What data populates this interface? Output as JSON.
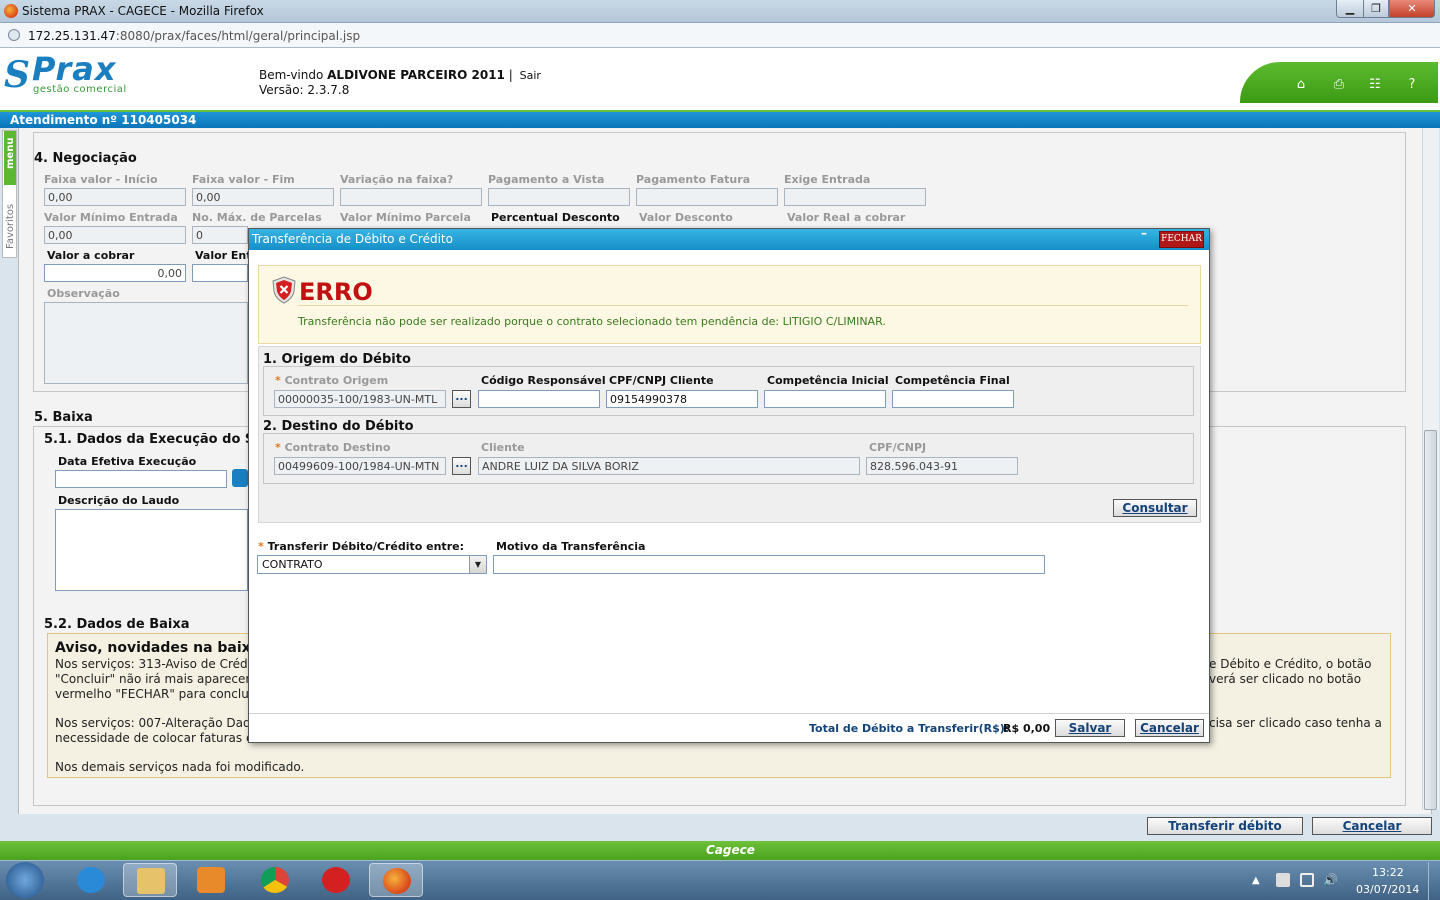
{
  "window": {
    "title": "Sistema PRAX - CAGECE - Mozilla Firefox",
    "url_host": "172.25.131.47",
    "url_path": ":8080/prax/faces/html/geral/principal.jsp"
  },
  "header": {
    "logo_text": "Prax",
    "logo_sub": "gestão comercial",
    "welcome_prefix": "Bem-vindo",
    "user_name": "ALDIVONE PARCEIRO 2011",
    "separator": "|",
    "sair": "Sair",
    "version": "Versão: 2.3.7.8"
  },
  "atendimento": "Atendimento nº 110405034",
  "sidebar": {
    "menu": "menu",
    "favoritos": "Favoritos"
  },
  "negociacao": {
    "title": "4. Negociação",
    "row1": [
      {
        "label": "Faixa valor - Início",
        "value": "0,00"
      },
      {
        "label": "Faixa valor - Fim",
        "value": "0,00"
      },
      {
        "label": "Variação na faixa?",
        "value": ""
      },
      {
        "label": "Pagamento a Vista",
        "value": ""
      },
      {
        "label": "Pagamento Fatura",
        "value": ""
      },
      {
        "label": "Exige Entrada",
        "value": ""
      }
    ],
    "row2": [
      {
        "label": "Valor Mínimo Entrada",
        "value": "0,00"
      },
      {
        "label": "No. Máx. de Parcelas",
        "value": "0"
      },
      {
        "label": "Valor Mínimo Parcela",
        "value": ""
      },
      {
        "label": "Percentual Desconto",
        "value": ""
      },
      {
        "label": "Valor Desconto",
        "value": ""
      },
      {
        "label": "Valor Real a cobrar",
        "value": ""
      }
    ],
    "valor_cobrar_label": "Valor a cobrar",
    "valor_cobrar_value": "0,00",
    "valor_entrada_label": "Valor Ent",
    "observacao_label": "Observação"
  },
  "baixa": {
    "title": "5. Baixa",
    "sub1": "5.1. Dados da Execução do S",
    "data_label": "Data Efetiva Execução",
    "laudo_label": "Descrição do Laudo",
    "sub2": "5.2. Dados de Baixa",
    "aviso_title": "Aviso, novidades na baixa",
    "aviso_l1a": "Nos serviços: 313-Aviso de Crédit",
    "aviso_l1b": "e Débito e Crédito, o botão",
    "aviso_l2a": "\"Concluir\" não irá mais aparecer",
    "aviso_l2b": "verá ser clicado no botão",
    "aviso_l3a": "vermelho \"FECHAR\" para concluir",
    "aviso_l4a": "Nos serviços: 007-Alteração Dado",
    "aviso_l4b": "cisa ser clicado caso tenha a",
    "aviso_l5a": "necessidade de colocar faturas en",
    "aviso_l6": "Nos demais serviços nada foi modificado."
  },
  "bottom_buttons": {
    "transferir": "Transferir débito",
    "cancelar": "Cancelar"
  },
  "footer": "Cagece",
  "taskbar": {
    "time": "13:22",
    "date": "03/07/2014"
  },
  "dialog": {
    "title": "Transferência de Débito e Crédito",
    "fechar": "FECHAR",
    "minimize": "–",
    "erro_title": "ERRO",
    "erro_msg": "Transferência não pode ser realizado porque o contrato selecionado tem pendência de: LITIGIO C/LIMINAR.",
    "origem": {
      "title": "1. Origem do Débito",
      "contrato_label": "Contrato Origem",
      "contrato_value": "00000035-100/1983-UN-MTL",
      "codigo_label": "Código Responsável",
      "codigo_value": "",
      "cpf_label": "CPF/CNPJ Cliente",
      "cpf_value": "09154990378",
      "comp_ini_label": "Competência Inicial",
      "comp_ini_value": "",
      "comp_fim_label": "Competência Final",
      "comp_fim_value": ""
    },
    "destino": {
      "title": "2. Destino do Débito",
      "contrato_label": "Contrato Destino",
      "contrato_value": "00499609-100/1984-UN-MTN",
      "cliente_label": "Cliente",
      "cliente_value": "ANDRE LUIZ DA SILVA BORIZ",
      "cpf_label": "CPF/CNPJ",
      "cpf_value": "828.596.043-91"
    },
    "dots": "...",
    "consultar": "Consultar",
    "transferir_entre_label": "Transferir Débito/Crédito entre:",
    "transferir_entre_value": "CONTRATO",
    "motivo_label": "Motivo da Transferência",
    "motivo_value": "",
    "total_label": "Total de Débito a Transferir(R$):",
    "total_value": "R$ 0,00",
    "salvar": "Salvar",
    "cancelar": "Cancelar"
  }
}
